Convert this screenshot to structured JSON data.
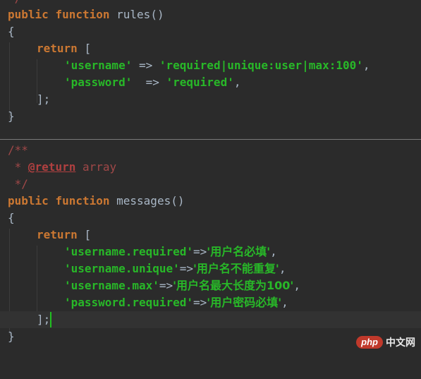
{
  "code": {
    "l0_top": "*/",
    "l1": {
      "kw1": "public",
      "kw2": "function",
      "name": "rules",
      "tail": "()"
    },
    "l2": "{",
    "l3": {
      "kw": "return",
      "tail": "["
    },
    "l4": {
      "key": "'username'",
      "arrow": "=>",
      "val": "'required|unique:user|max:100'",
      "end": ","
    },
    "l5": {
      "key": "'password'",
      "arrow": "=>",
      "val": "'required'",
      "end": ","
    },
    "l6": "];",
    "l7": "}",
    "l8": "/**",
    "l9": {
      "star": " * ",
      "tag": "@return",
      "type": " array"
    },
    "l10": " */",
    "l11": {
      "kw1": "public",
      "kw2": "function",
      "name": "messages",
      "tail": "()"
    },
    "l12": "{",
    "l13": {
      "kw": "return",
      "tail": "["
    },
    "l14": {
      "key": "'username.required'",
      "arrow": "=>",
      "val": "'用户名必填'",
      "end": ","
    },
    "l15": {
      "key": "'username.unique'",
      "arrow": "=>",
      "val": "'用户名不能重复'",
      "end": ","
    },
    "l16": {
      "key": "'username.max'",
      "arrow": "=>",
      "val": "'用户名最大长度为100'",
      "end": ","
    },
    "l17": {
      "key": "'password.required'",
      "arrow": "=>",
      "val": "'用户密码必填'",
      "end": ","
    },
    "l18": "];",
    "l19": "}"
  },
  "watermark": {
    "badge": "php",
    "text": "中文网"
  },
  "colors": {
    "background": "#2b2b2b",
    "keyword": "#cc7832",
    "string": "#28b828",
    "comment": "#a04848",
    "caret": "#20c020"
  }
}
